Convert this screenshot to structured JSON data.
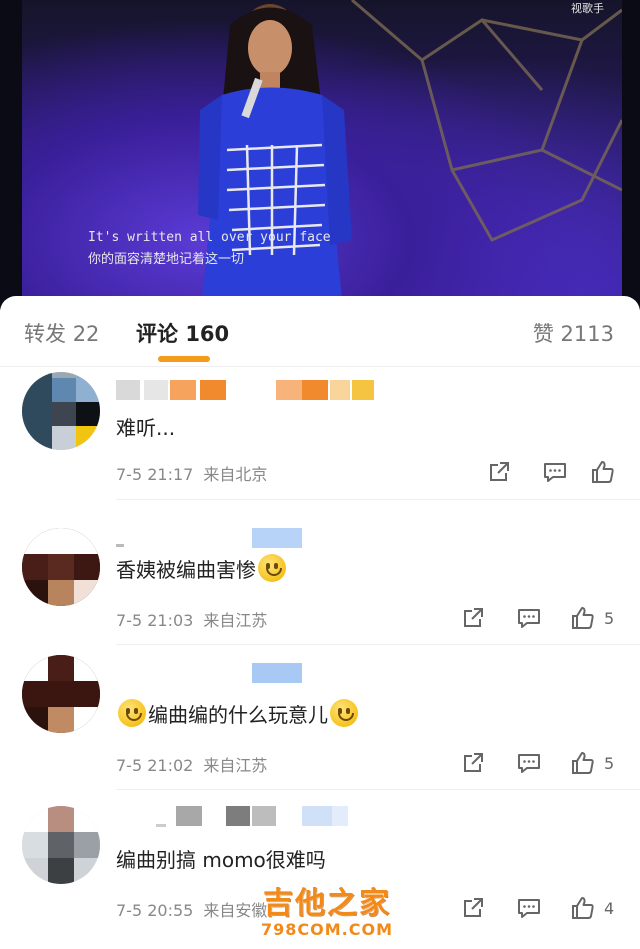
{
  "video": {
    "channel_watermark": "视歌手",
    "subtitle_en": "It's written all over your face",
    "subtitle_cn": "你的面容清楚地记着这一切"
  },
  "tabs": {
    "repost_label": "转发",
    "repost_count": "22",
    "comment_label": "评论",
    "comment_count": "160",
    "like_label": "赞",
    "like_count": "2113",
    "accent": "#f49b1c"
  },
  "comments": [
    {
      "text": "难听...",
      "date": "7-5 21:17",
      "location": "来自北京",
      "likes": ""
    },
    {
      "text": "香姨被编曲害惨",
      "date": "7-5 21:03",
      "location": "来自江苏",
      "likes": "5"
    },
    {
      "text_before": "",
      "text": "编曲编的什么玩意儿",
      "date": "7-5 21:02",
      "location": "来自江苏",
      "likes": "5"
    },
    {
      "text": "编曲别搞 momo很难吗",
      "date": "7-5 20:55",
      "location": "来自安徽",
      "likes": "4"
    }
  ],
  "icons": [
    "share-icon",
    "comment-icon",
    "thumb-up-icon",
    "smile-emoji-icon"
  ],
  "site_watermark": {
    "cn": "吉他之家",
    "en": "798COM.COM"
  }
}
